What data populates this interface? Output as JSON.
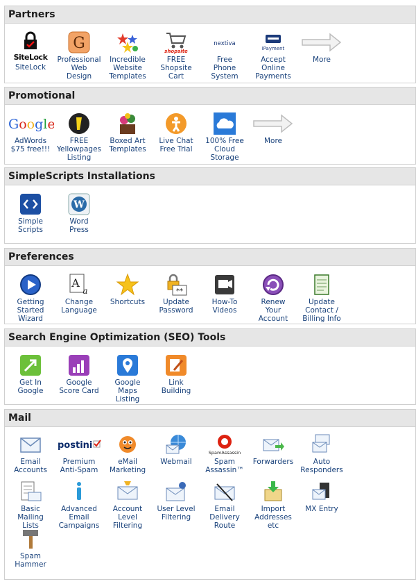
{
  "sections": [
    {
      "title": "Partners",
      "items": [
        {
          "name": "sitelock",
          "label": "SiteLock",
          "icon": "sitelock-icon"
        },
        {
          "name": "professional-web-design",
          "label": "Professional\nWeb\nDesign",
          "icon": "web-design-icon"
        },
        {
          "name": "website-templates",
          "label": "Incredible\nWebsite\nTemplates",
          "icon": "templates-icon"
        },
        {
          "name": "shopsite-cart",
          "label": "FREE\nShopsite\nCart",
          "icon": "shopsite-cart-icon"
        },
        {
          "name": "free-phone",
          "label": "Free\nPhone\nSystem",
          "icon": "nextiva-icon"
        },
        {
          "name": "online-payments",
          "label": "Accept\nOnline\nPayments",
          "icon": "ipayment-icon"
        },
        {
          "name": "partners-more",
          "label": "More",
          "icon": "arrow-right-icon"
        }
      ]
    },
    {
      "title": "Promotional",
      "items": [
        {
          "name": "adwords",
          "label": "AdWords\n$75 free!!!",
          "icon": "google-icon"
        },
        {
          "name": "yellowpages",
          "label": "FREE\nYellowpages\nListing",
          "icon": "yellowpages-icon"
        },
        {
          "name": "boxed-art",
          "label": "Boxed Art\nTemplates",
          "icon": "boxed-art-icon"
        },
        {
          "name": "live-chat",
          "label": "Live Chat\nFree Trial",
          "icon": "live-chat-icon"
        },
        {
          "name": "cloud-storage",
          "label": "100% Free\nCloud\nStorage",
          "icon": "cloud-icon"
        },
        {
          "name": "promotional-more",
          "label": "More",
          "icon": "arrow-right-icon"
        }
      ]
    },
    {
      "title": "SimpleScripts Installations",
      "items": [
        {
          "name": "simple-scripts",
          "label": "Simple\nScripts",
          "icon": "simplescripts-icon"
        },
        {
          "name": "wordpress",
          "label": "Word\nPress",
          "icon": "wordpress-icon"
        }
      ]
    },
    {
      "title": "Preferences",
      "items": [
        {
          "name": "getting-started",
          "label": "Getting\nStarted\nWizard",
          "icon": "play-icon"
        },
        {
          "name": "change-language",
          "label": "Change\nLanguage",
          "icon": "language-icon"
        },
        {
          "name": "shortcuts",
          "label": "Shortcuts",
          "icon": "star-icon"
        },
        {
          "name": "update-password",
          "label": "Update\nPassword",
          "icon": "lock-password-icon"
        },
        {
          "name": "how-to-videos",
          "label": "How-To\nVideos",
          "icon": "video-icon"
        },
        {
          "name": "renew-account",
          "label": "Renew\nYour\nAccount",
          "icon": "renew-icon"
        },
        {
          "name": "update-contact",
          "label": "Update\nContact /\nBilling Info",
          "icon": "notepad-icon"
        }
      ]
    },
    {
      "title": "Search Engine Optimization (SEO) Tools",
      "items": [
        {
          "name": "get-in-google",
          "label": "Get In\nGoogle",
          "icon": "get-in-google-icon"
        },
        {
          "name": "google-score-card",
          "label": "Google\nScore Card",
          "icon": "score-card-icon"
        },
        {
          "name": "google-maps-listing",
          "label": "Google\nMaps\nListing",
          "icon": "maps-pin-icon"
        },
        {
          "name": "link-building",
          "label": "Link\nBuilding",
          "icon": "link-building-icon"
        }
      ]
    },
    {
      "title": "Mail",
      "items": [
        {
          "name": "email-accounts",
          "label": "Email\nAccounts",
          "icon": "envelope-icon"
        },
        {
          "name": "postini",
          "label": "Premium\nAnti-Spam",
          "icon": "postini-icon"
        },
        {
          "name": "email-marketing",
          "label": "eMail\nMarketing",
          "icon": "mascot-icon"
        },
        {
          "name": "webmail",
          "label": "Webmail",
          "icon": "globe-mail-icon"
        },
        {
          "name": "spam-assassin",
          "label": "Spam\nAssassin™",
          "icon": "spamassassin-icon"
        },
        {
          "name": "forwarders",
          "label": "Forwarders",
          "icon": "forwarders-icon"
        },
        {
          "name": "auto-responders",
          "label": "Auto\nResponders",
          "icon": "autoresponder-icon"
        },
        {
          "name": "mailing-lists",
          "label": "Basic\nMailing\nLists",
          "icon": "mailing-list-icon"
        },
        {
          "name": "email-campaigns",
          "label": "Advanced\nEmail\nCampaigns",
          "icon": "info-mail-icon"
        },
        {
          "name": "account-filtering",
          "label": "Account\nLevel\nFiltering",
          "icon": "filter-mail-icon"
        },
        {
          "name": "user-filtering",
          "label": "User Level\nFiltering",
          "icon": "user-filter-icon"
        },
        {
          "name": "delivery-route",
          "label": "Email\nDelivery\nRoute",
          "icon": "route-mail-icon"
        },
        {
          "name": "import-addresses",
          "label": "Import\nAddresses\netc",
          "icon": "import-icon"
        },
        {
          "name": "mx-entry",
          "label": "MX Entry",
          "icon": "mx-icon"
        },
        {
          "name": "spam-hammer",
          "label": "Spam\nHammer",
          "icon": "hammer-icon"
        }
      ]
    }
  ],
  "logos": {
    "sitelock": "SiteLock",
    "nextiva": "nextiva",
    "ipayment": "iPayment",
    "google": "Google",
    "postini": "postini",
    "shopsite": "shopsite",
    "spamassassin": "SpamAssassin"
  }
}
